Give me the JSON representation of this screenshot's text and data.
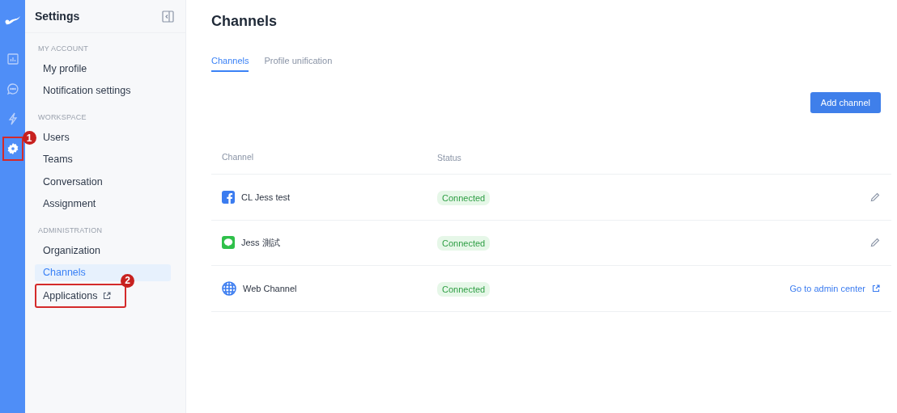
{
  "rail": {
    "items": [
      {
        "kind": "chart",
        "selected": false
      },
      {
        "kind": "chat",
        "selected": false
      },
      {
        "kind": "bolt",
        "selected": false
      },
      {
        "kind": "gear",
        "selected": true,
        "callout": "1"
      }
    ]
  },
  "sidebar": {
    "title": "Settings",
    "sections": [
      {
        "heading": "MY ACCOUNT",
        "items": [
          {
            "label": "My profile",
            "selected": false,
            "external": false
          },
          {
            "label": "Notification settings",
            "selected": false,
            "external": false
          }
        ]
      },
      {
        "heading": "WORKSPACE",
        "items": [
          {
            "label": "Users",
            "selected": false,
            "external": false
          },
          {
            "label": "Teams",
            "selected": false,
            "external": false
          },
          {
            "label": "Conversation",
            "selected": false,
            "external": false
          },
          {
            "label": "Assignment",
            "selected": false,
            "external": false
          }
        ]
      },
      {
        "heading": "ADMINISTRATION",
        "items": [
          {
            "label": "Organization",
            "selected": false,
            "external": false
          },
          {
            "label": "Channels",
            "selected": true,
            "external": false
          },
          {
            "label": "Applications",
            "selected": false,
            "external": true,
            "callout": "2"
          }
        ]
      }
    ]
  },
  "page": {
    "title": "Channels"
  },
  "tabs": [
    {
      "label": "Channels",
      "selected": true
    },
    {
      "label": "Profile unification",
      "selected": false
    }
  ],
  "add_button": "Add channel",
  "table": {
    "columns": [
      "Channel",
      "Status"
    ],
    "rows": [
      {
        "kind": "facebook",
        "name": "CL Jess test",
        "status": "Connected",
        "action": {
          "kind": "edit"
        }
      },
      {
        "kind": "line",
        "name": "Jess 測試",
        "status": "Connected",
        "action": {
          "kind": "edit"
        }
      },
      {
        "kind": "web",
        "name": "Web Channel",
        "status": "Connected",
        "action": {
          "kind": "link",
          "label": "Go to admin center"
        }
      }
    ]
  }
}
